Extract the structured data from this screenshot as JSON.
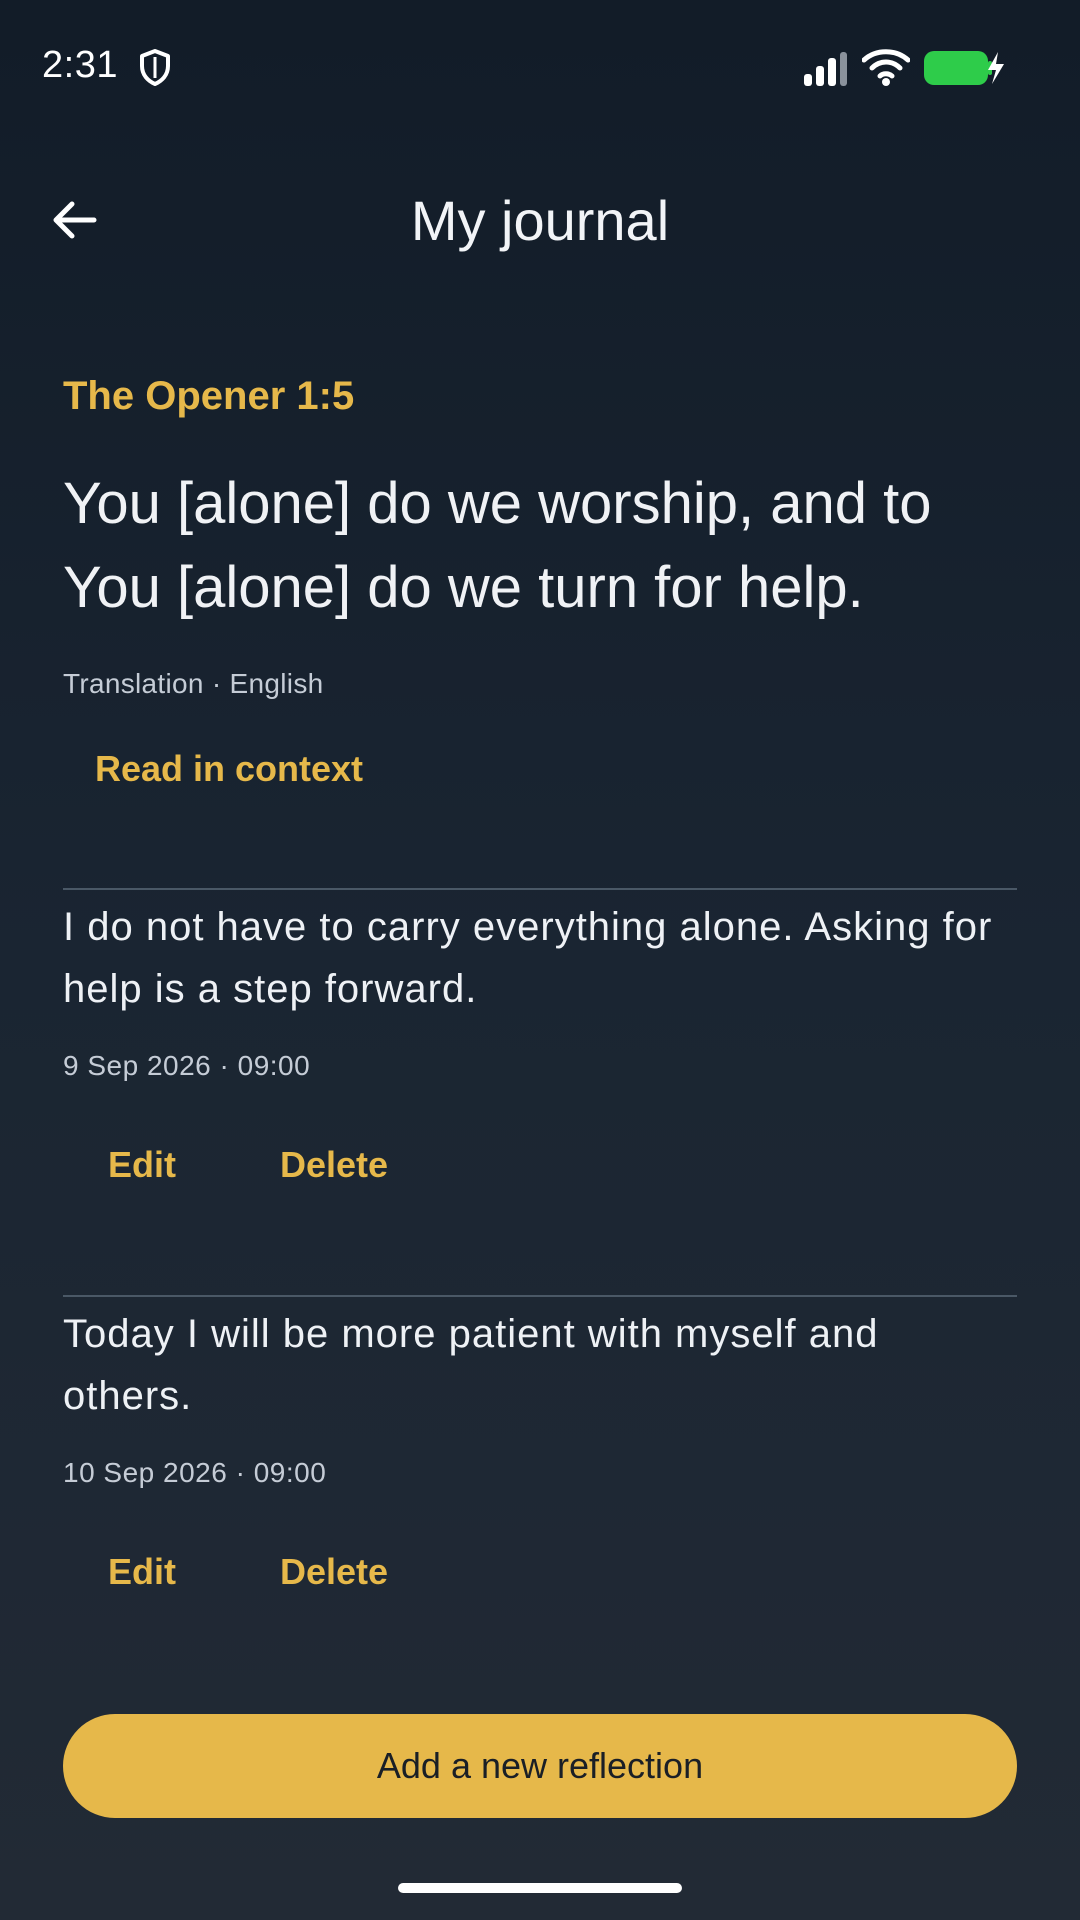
{
  "status_bar": {
    "time": "2:31",
    "icons": [
      "shield-icon",
      "signal-icon",
      "wifi-icon",
      "battery-charging-icon"
    ],
    "battery_color": "#2ecc4a"
  },
  "header": {
    "title": "My journal",
    "back_icon": "arrow-left-icon"
  },
  "verse": {
    "reference": "The Opener 1:5",
    "text": "You [alone] do we worship, and to You [alone] do we turn for help.",
    "meta": "Translation · English",
    "read_in_context_label": "Read in context"
  },
  "entries": [
    {
      "text": "I do not have to carry everything alone. Asking for help is a step forward.",
      "date": "9 Sep 2026 · 09:00",
      "edit_label": "Edit",
      "delete_label": "Delete"
    },
    {
      "text": "Today I will be more patient with myself and others.",
      "date": "10 Sep 2026 · 09:00",
      "edit_label": "Edit",
      "delete_label": "Delete"
    }
  ],
  "add_button_label": "Add a new reflection",
  "colors": {
    "accent": "#e6b84a",
    "background_top": "#121c28",
    "background_bottom": "#222a35",
    "text": "#eef1f5",
    "muted_text": "#c5ccd6",
    "divider": "#4a5866"
  }
}
